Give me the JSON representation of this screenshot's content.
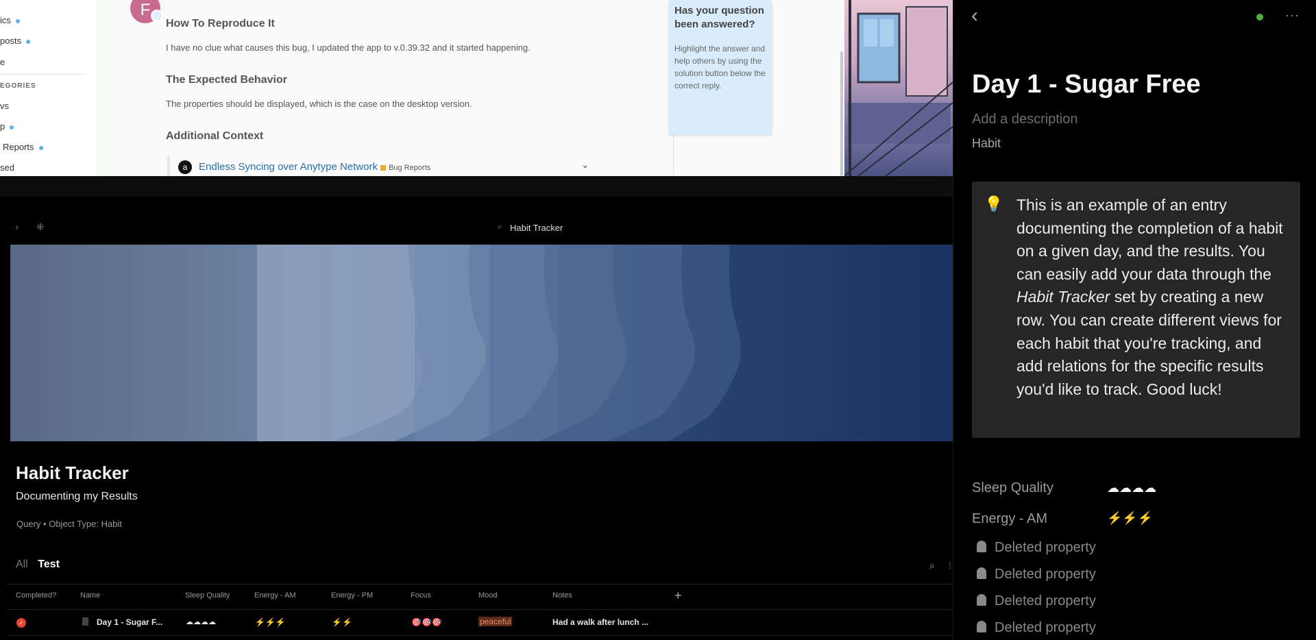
{
  "forum": {
    "avatar_letter": "F",
    "sidebar": {
      "items": [
        {
          "label": "ics",
          "dot": true
        },
        {
          "label": "posts",
          "dot": true
        },
        {
          "label": "e",
          "dot": false
        },
        {
          "label": "vs",
          "dot": false
        },
        {
          "label": "p",
          "dot": true
        },
        {
          "label": "Reports",
          "dot": true
        },
        {
          "label": "sed",
          "dot": false
        }
      ],
      "section_label": "EGORIES"
    },
    "post": {
      "h_reproduce": "How To Reproduce It",
      "p_reproduce": "I have no clue what causes this bug, I updated the app to v.0.39.32 and it started happening.",
      "h_expected": "The Expected Behavior",
      "p_expected": "The properties should be displayed, which is the case on the desktop version.",
      "h_context": "Additional Context",
      "onebox_link": "Endless Syncing over Anytype Network",
      "onebox_tag": "Bug Reports"
    },
    "callout": {
      "title": "Has your question been answered?",
      "body": "Highlight the answer and help others by using the solution button below the correct reply."
    }
  },
  "topbar": {
    "title": "Habit Tracker"
  },
  "set": {
    "title": "Habit Tracker",
    "description": "Documenting my Results",
    "meta_query": "Query",
    "meta_sep": "•",
    "meta_type": "Object Type: Habit",
    "tabs": [
      {
        "label": "All",
        "active": false
      },
      {
        "label": "Test",
        "active": true
      }
    ],
    "columns": {
      "completed": "Completed?",
      "name": "Name",
      "sleep": "Sleep Quality",
      "energy_am": "Energy - AM",
      "energy_pm": "Energy - PM",
      "focus": "Focus",
      "mood": "Mood",
      "notes": "Notes"
    },
    "add_column": "+",
    "row": {
      "completed": true,
      "name": "Day 1 - Sugar F...",
      "sleep": "☁☁☁☁",
      "energy_am": "⚡⚡⚡",
      "energy_pm": "⚡⚡",
      "focus": "🎯🎯🎯",
      "mood": "peaceful",
      "notes": "Had a walk after lunch ..."
    }
  },
  "panel": {
    "title": "Day 1 - Sugar Free",
    "description_placeholder": "Add a description",
    "type": "Habit",
    "callout_icon": "💡",
    "callout_text_1": "This is an example of an entry documenting the completion of a habit on a given day, and the results. You can easily add your data through the ",
    "callout_italic": "Habit Tracker",
    "callout_text_2": " set by creating a new row. You can create different views for each habit that you're tracking, and add relations for the specific results you'd like to track. Good luck!",
    "relations": [
      {
        "label": "Sleep Quality",
        "value": "☁☁☁☁"
      },
      {
        "label": "Energy - AM",
        "value": "⚡⚡⚡"
      }
    ],
    "deleted": [
      {
        "label": "Deleted property"
      },
      {
        "label": "Deleted property"
      },
      {
        "label": "Deleted property"
      },
      {
        "label": "Deleted property"
      }
    ]
  },
  "colors": {
    "accent_red": "#e5452f",
    "sync_green": "#4caf34",
    "mood_orange": "#ea8a63",
    "link_blue": "#2a6fa8"
  }
}
